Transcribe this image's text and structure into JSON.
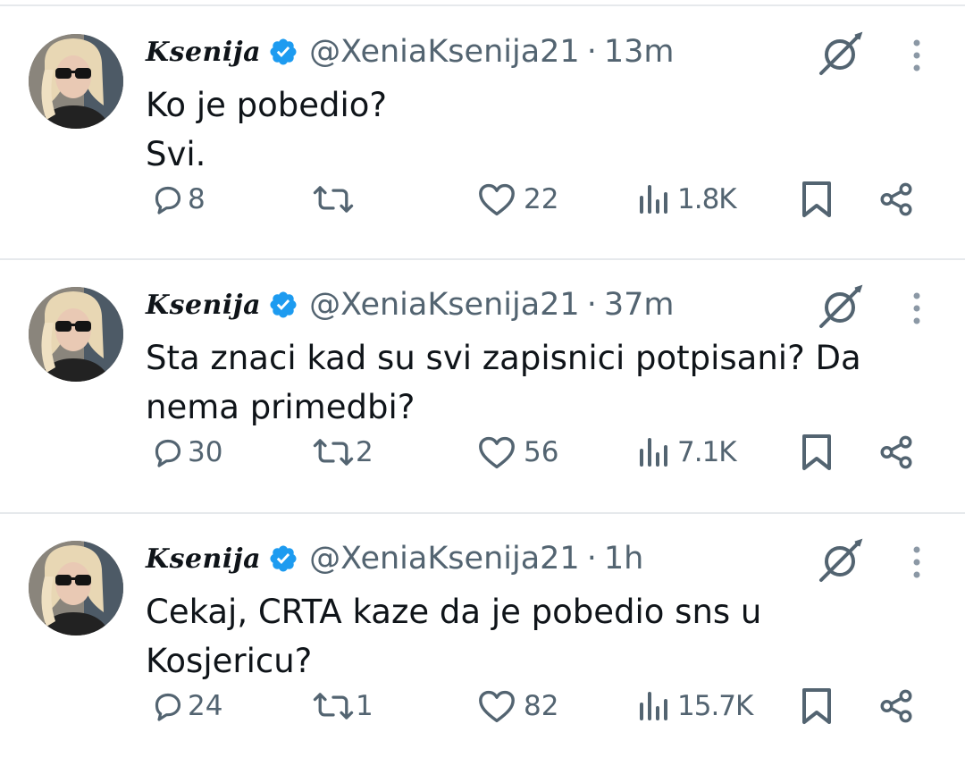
{
  "tweets": [
    {
      "display_name": "Ksenija",
      "handle": "@XeniaKsenija21",
      "separator": "·",
      "time": "13m",
      "text": "Ko je pobedio?\nSvi.",
      "replies": "8",
      "reposts": "",
      "likes": "22",
      "views": "1.8K"
    },
    {
      "display_name": "Ksenija",
      "handle": "@XeniaKsenija21",
      "separator": "·",
      "time": "37m",
      "text": "Sta znaci kad su svi zapisnici potpisani? Da\nnema primedbi?",
      "replies": "30",
      "reposts": "2",
      "likes": "56",
      "views": "7.1K"
    },
    {
      "display_name": "Ksenija",
      "handle": "@XeniaKsenija21",
      "separator": "·",
      "time": "1h",
      "text": "Cekaj, CRTA kaze da je pobedio sns u\nKosjericu?",
      "replies": "24",
      "reposts": "1",
      "likes": "82",
      "views": "15.7K"
    }
  ],
  "icons": {
    "verified": "verified-badge-icon",
    "grok": "grok-icon",
    "more": "more-vertical-icon",
    "reply": "reply-bubble-icon",
    "repost": "repost-icon",
    "like": "heart-icon",
    "views": "views-chart-icon",
    "bookmark": "bookmark-icon",
    "share": "share-icon"
  },
  "colors": {
    "text": "#0f1419",
    "secondary": "#536471",
    "verified": "#1d9bf0",
    "divider": "#e6e9ec"
  }
}
